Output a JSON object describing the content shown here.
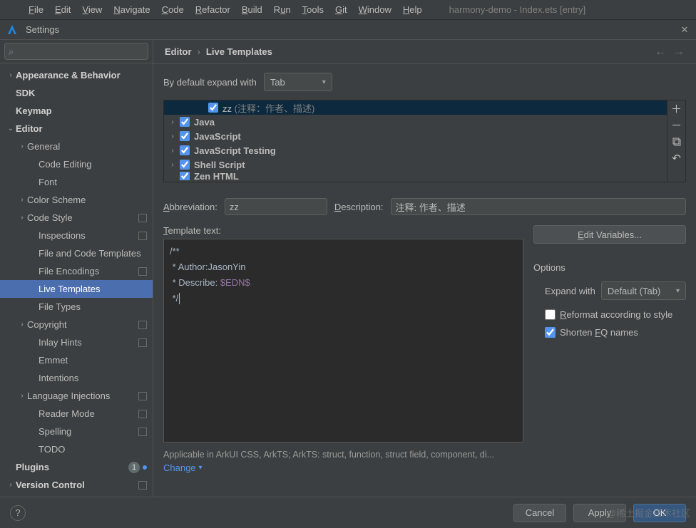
{
  "menubar": {
    "items": [
      "File",
      "Edit",
      "View",
      "Navigate",
      "Code",
      "Refactor",
      "Build",
      "Run",
      "Tools",
      "Git",
      "Window",
      "Help"
    ],
    "title": "harmony-demo - Index.ets [entry]"
  },
  "titlebar": {
    "title": "Settings"
  },
  "search": {
    "placeholder": ""
  },
  "sidebar_tree": [
    {
      "label": "Appearance & Behavior",
      "lvl": 0,
      "arrow": ">",
      "bold": true
    },
    {
      "label": "SDK",
      "lvl": 0,
      "arrow": "",
      "bold": true
    },
    {
      "label": "Keymap",
      "lvl": 0,
      "arrow": "",
      "bold": true
    },
    {
      "label": "Editor",
      "lvl": 0,
      "arrow": "v",
      "bold": true
    },
    {
      "label": "General",
      "lvl": 1,
      "arrow": ">"
    },
    {
      "label": "Code Editing",
      "lvl": 2,
      "arrow": ""
    },
    {
      "label": "Font",
      "lvl": 2,
      "arrow": ""
    },
    {
      "label": "Color Scheme",
      "lvl": 1,
      "arrow": ">"
    },
    {
      "label": "Code Style",
      "lvl": 1,
      "arrow": ">",
      "badge_sq": true
    },
    {
      "label": "Inspections",
      "lvl": 2,
      "arrow": "",
      "badge_sq": true
    },
    {
      "label": "File and Code Templates",
      "lvl": 2,
      "arrow": ""
    },
    {
      "label": "File Encodings",
      "lvl": 2,
      "arrow": "",
      "badge_sq": true
    },
    {
      "label": "Live Templates",
      "lvl": 2,
      "arrow": "",
      "selected": true
    },
    {
      "label": "File Types",
      "lvl": 2,
      "arrow": ""
    },
    {
      "label": "Copyright",
      "lvl": 1,
      "arrow": ">",
      "badge_sq": true
    },
    {
      "label": "Inlay Hints",
      "lvl": 2,
      "arrow": "",
      "badge_sq": true
    },
    {
      "label": "Emmet",
      "lvl": 2,
      "arrow": ""
    },
    {
      "label": "Intentions",
      "lvl": 2,
      "arrow": ""
    },
    {
      "label": "Language Injections",
      "lvl": 1,
      "arrow": ">",
      "badge_sq": true
    },
    {
      "label": "Reader Mode",
      "lvl": 2,
      "arrow": "",
      "badge_sq": true
    },
    {
      "label": "Spelling",
      "lvl": 2,
      "arrow": "",
      "badge_sq": true
    },
    {
      "label": "TODO",
      "lvl": 2,
      "arrow": ""
    },
    {
      "label": "Plugins",
      "lvl": 0,
      "arrow": "",
      "bold": true,
      "badge": "1"
    },
    {
      "label": "Version Control",
      "lvl": 0,
      "arrow": ">",
      "bold": true,
      "badge_sq": true
    }
  ],
  "breadcrumb": {
    "root": "Editor",
    "leaf": "Live Templates"
  },
  "expand_default": {
    "label": "By default expand with",
    "value": "Tab"
  },
  "groups": [
    {
      "indent": 2,
      "checked": true,
      "abbr": "zz",
      "desc": " (注释：作者、描述)",
      "selected": true
    },
    {
      "indent": 0,
      "arrow": ">",
      "checked": true,
      "name": "Java",
      "bold": true
    },
    {
      "indent": 0,
      "arrow": ">",
      "checked": true,
      "name": "JavaScript",
      "bold": true
    },
    {
      "indent": 0,
      "arrow": ">",
      "checked": true,
      "name": "JavaScript Testing",
      "bold": true
    },
    {
      "indent": 0,
      "arrow": ">",
      "checked": true,
      "name": "Shell Script",
      "bold": true
    },
    {
      "indent": 0,
      "arrow": "",
      "checked": true,
      "name": "Zen HTML",
      "bold": true,
      "cut": true
    }
  ],
  "abbrev": {
    "label": "Abbreviation:",
    "value": "zz"
  },
  "desc": {
    "label": "Description:",
    "value": "注释: 作者、描述"
  },
  "template_text": {
    "label": "Template text:",
    "line1": "/**",
    "line2": " * Author:JasonYin",
    "line3_a": " * Describe: ",
    "line3_b": "$EDN$",
    "line4": " */"
  },
  "edit_vars": "Edit Variables...",
  "options": {
    "title": "Options",
    "expand_with_label": "Expand with",
    "expand_with_value": "Default (Tab)",
    "reformat": "Reformat according to style",
    "reformat_checked": false,
    "shorten": "Shorten FQ names",
    "shorten_checked": true
  },
  "applicable": "Applicable in ArkUI CSS, ArkTS; ArkTS: struct, function, struct field, component, di...",
  "change": "Change",
  "footer": {
    "cancel": "Cancel",
    "apply": "Apply",
    "ok": "OK"
  },
  "watermark": "@稀土掘金技术社区"
}
